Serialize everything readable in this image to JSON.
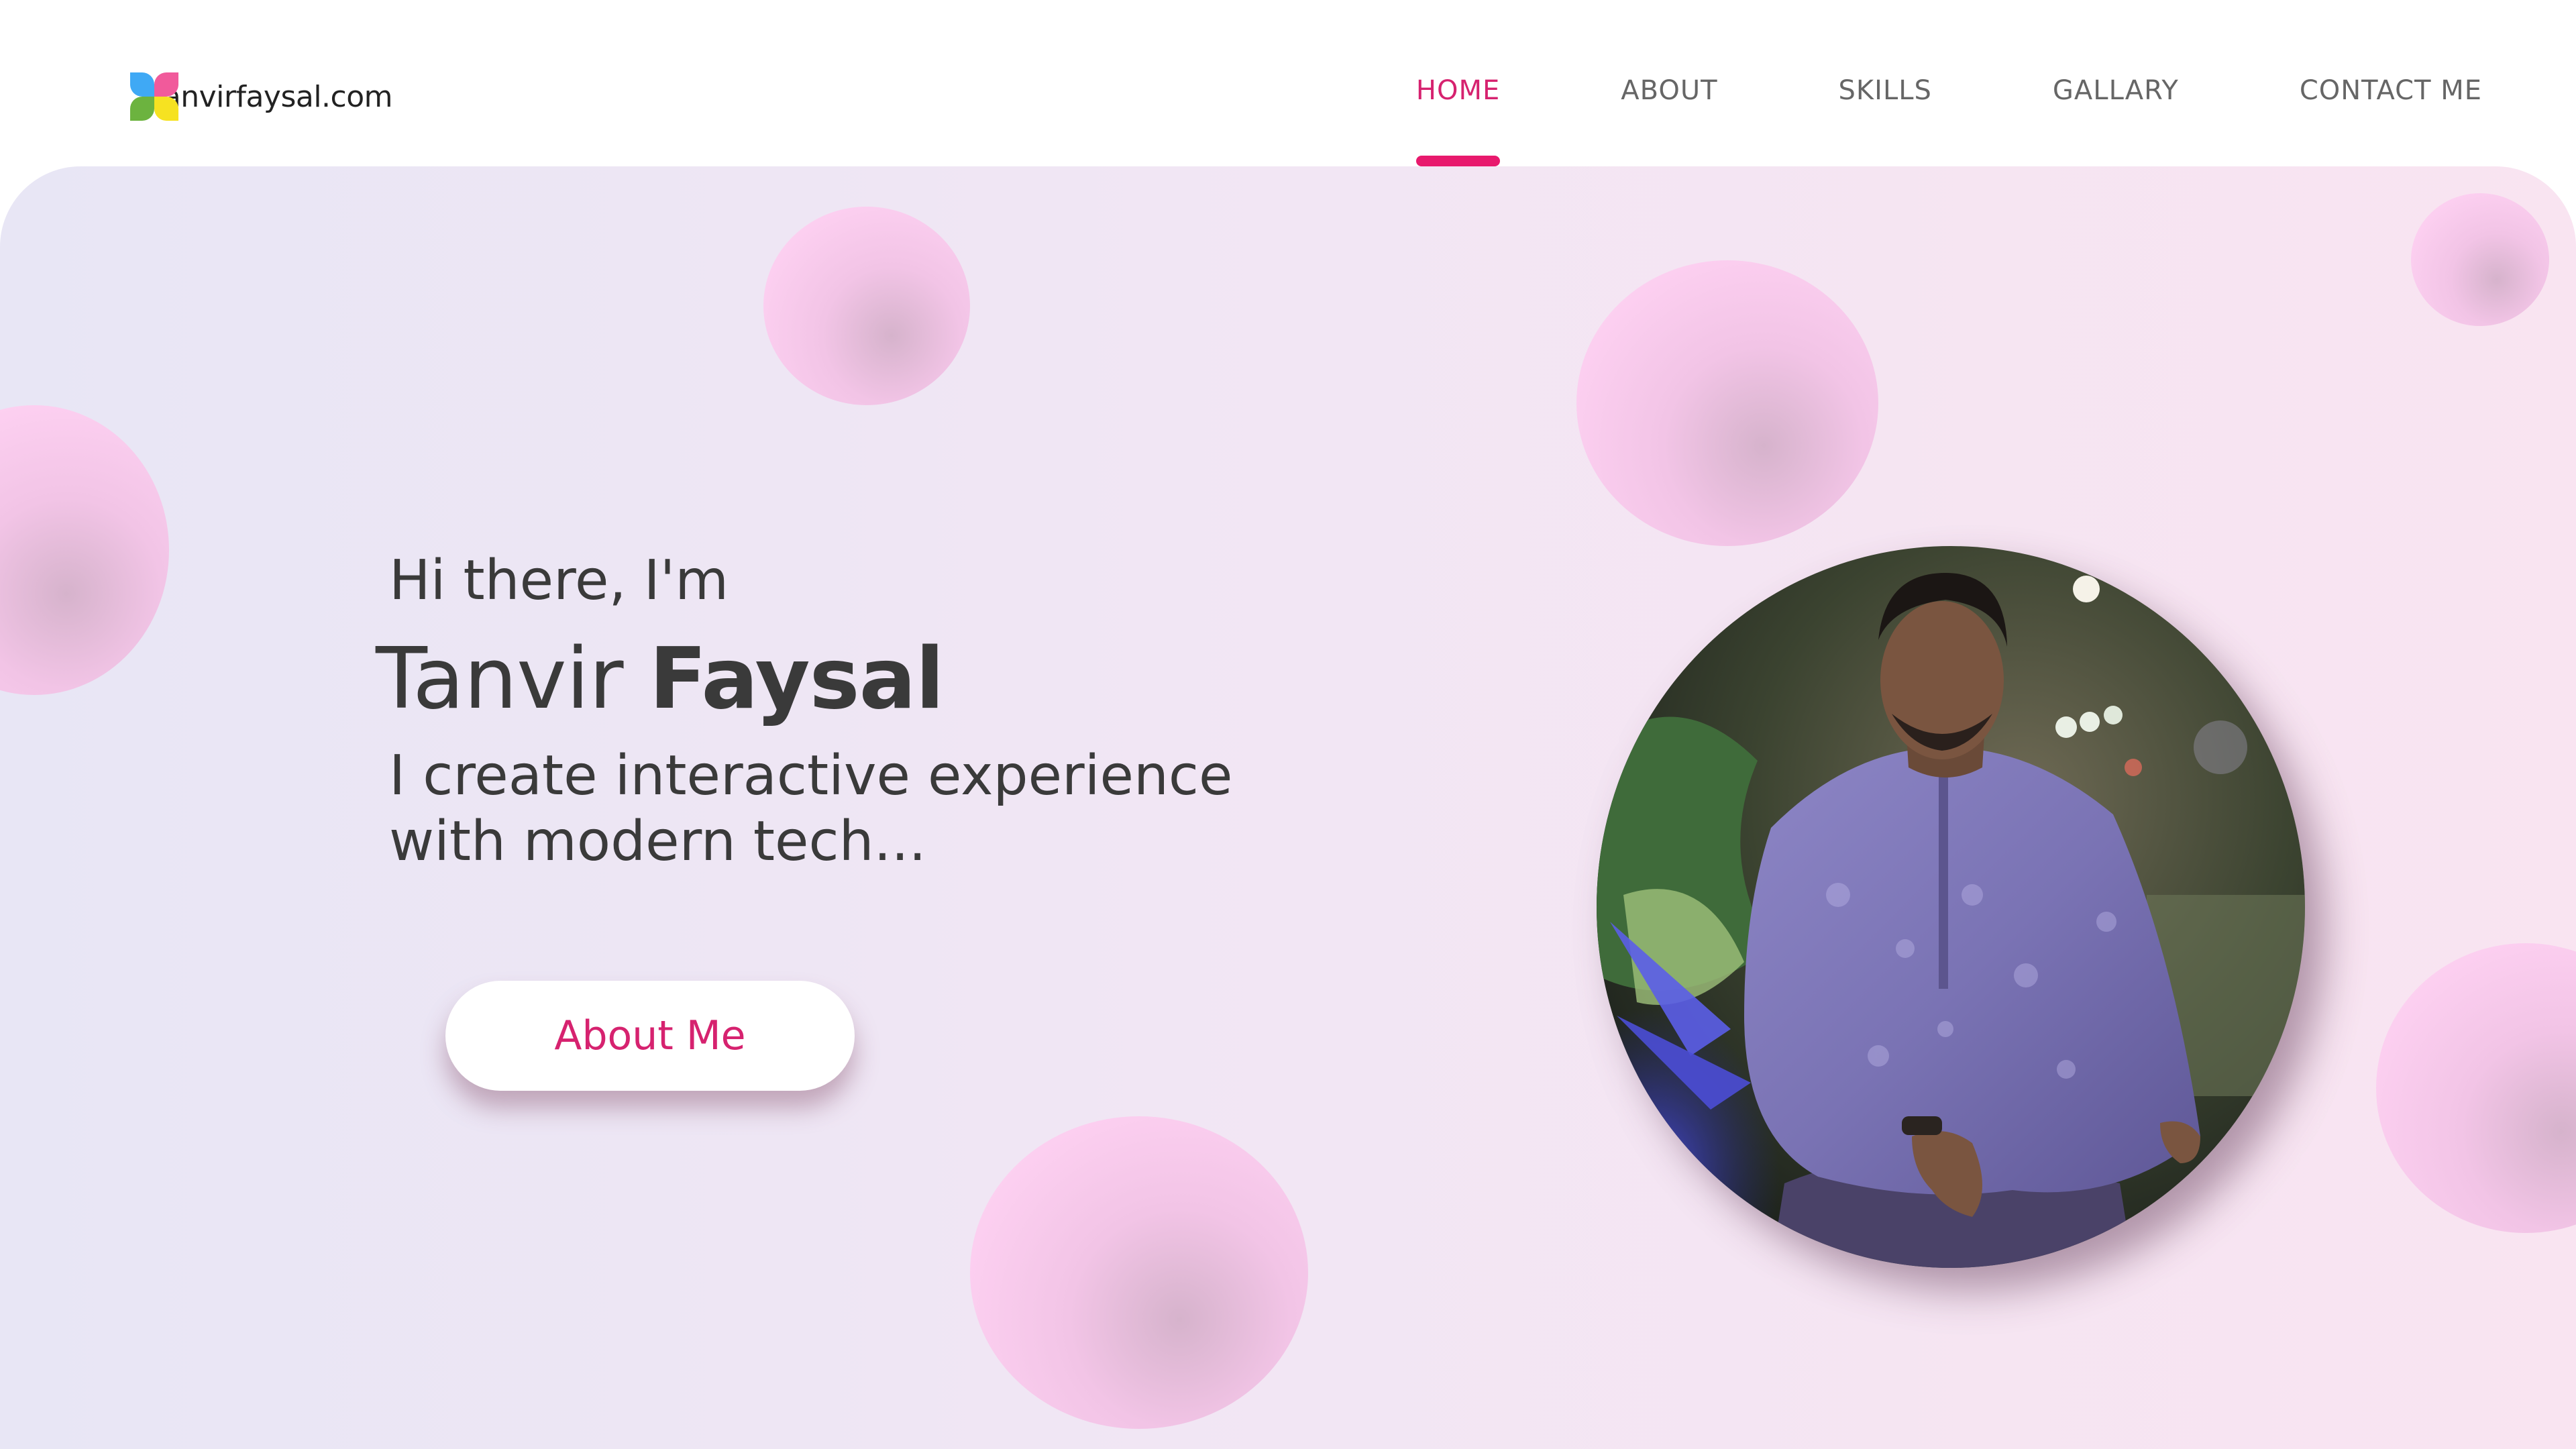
{
  "brand": {
    "logo_text": "tanvirfaysal.com",
    "logo_colors": [
      "#3fa9f5",
      "#f15a9b",
      "#6cb33f",
      "#f6e221"
    ]
  },
  "nav": {
    "items": [
      {
        "label": "HOME",
        "active": true
      },
      {
        "label": "ABOUT",
        "active": false
      },
      {
        "label": "SKILLS",
        "active": false
      },
      {
        "label": "GALLARY",
        "active": false
      },
      {
        "label": "CONTACT ME",
        "active": false
      }
    ],
    "active_color": "#d6226f",
    "underline_color": "#e8196d"
  },
  "hero": {
    "greeting": "Hi there, I'm",
    "name_first": "Tanvir",
    "name_last": "Faysal",
    "tagline_line1": "I create interactive experience",
    "tagline_line2": "with modern tech...",
    "cta_label": "About Me",
    "accent_color": "#d6226f"
  },
  "portrait": {
    "image": "portrait-photo"
  }
}
